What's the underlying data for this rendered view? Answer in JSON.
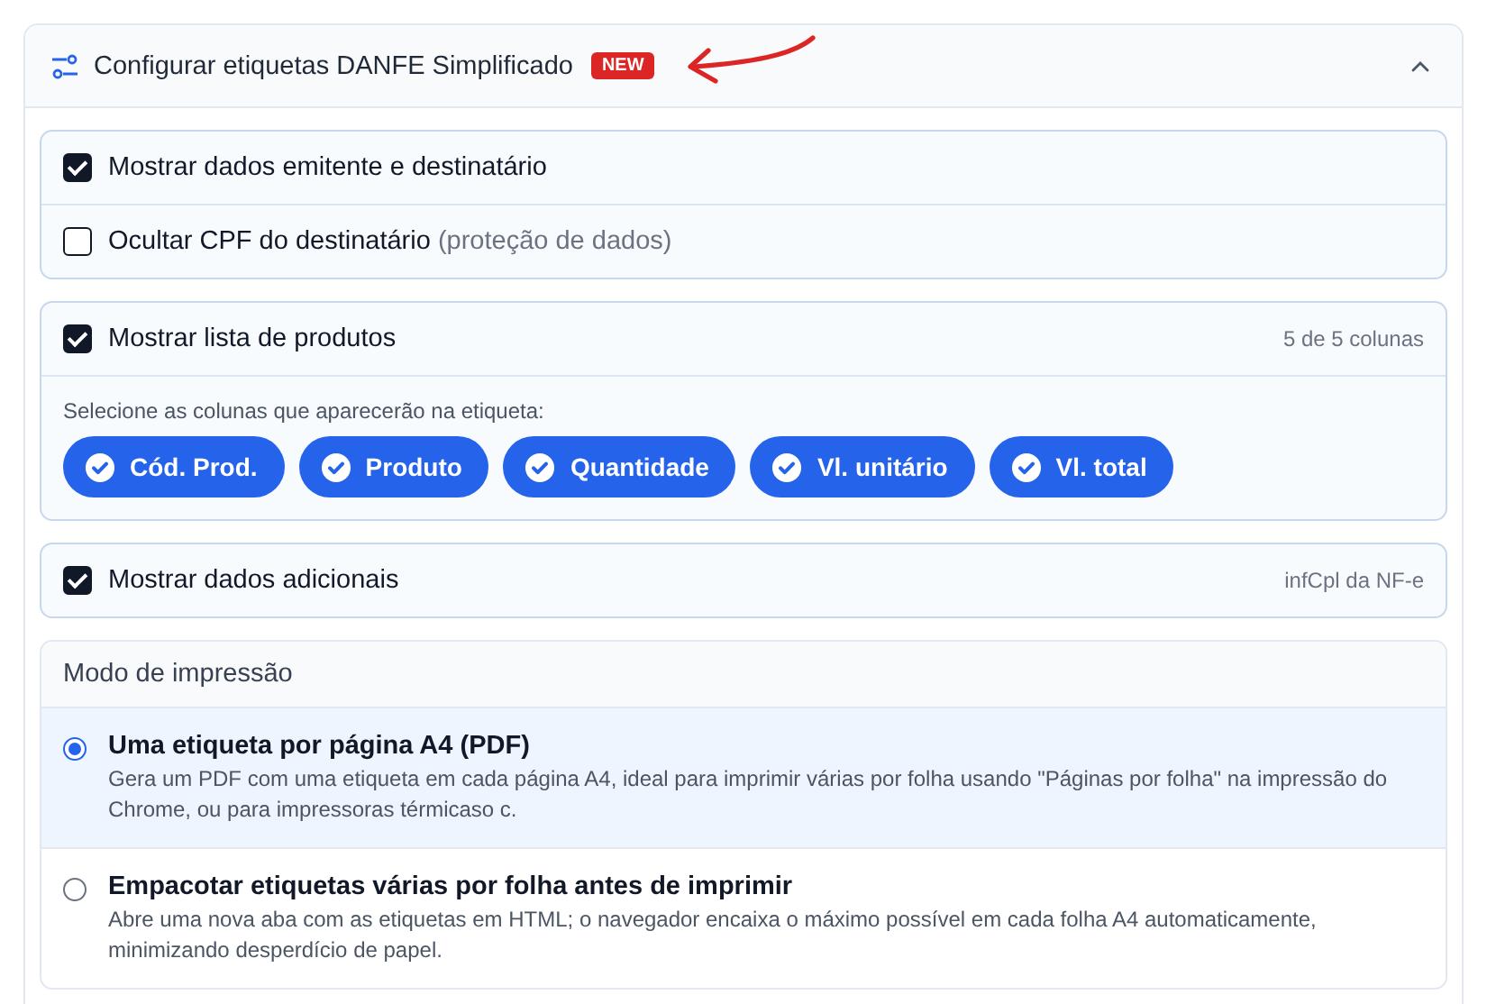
{
  "panel": {
    "title": "Configurar etiquetas DANFE Simplificado",
    "badge": "NEW",
    "expanded": true
  },
  "party_options": [
    {
      "label": "Mostrar dados emitente e destinatário",
      "checked": true
    },
    {
      "label": "Ocultar CPF do destinatário",
      "note": "(proteção de dados)",
      "checked": false
    }
  ],
  "products": {
    "label": "Mostrar lista de produtos",
    "checked": true,
    "counter": "5 de 5 colunas",
    "hint": "Selecione as colunas que aparecerão na etiqueta:",
    "columns": [
      {
        "label": "Cód. Prod.",
        "selected": true
      },
      {
        "label": "Produto",
        "selected": true
      },
      {
        "label": "Quantidade",
        "selected": true
      },
      {
        "label": "Vl. unitário",
        "selected": true
      },
      {
        "label": "Vl. total",
        "selected": true
      }
    ]
  },
  "additional": {
    "label": "Mostrar dados adicionais",
    "checked": true,
    "note": "infCpl da NF-e"
  },
  "print_mode": {
    "title": "Modo de impressão",
    "options": [
      {
        "label": "Uma etiqueta por página A4 (PDF)",
        "description": "Gera um PDF com uma etiqueta em cada página A4, ideal para imprimir várias por folha usando \"Páginas por folha\" na impressão do Chrome, ou para impressoras térmicaso c.",
        "selected": true
      },
      {
        "label": "Empacotar etiquetas várias por folha antes de imprimir",
        "description": "Abre uma nova aba com as etiquetas em HTML; o navegador encaixa o máximo possível em cada folha A4 automaticamente, minimizando desperdício de papel.",
        "selected": false
      }
    ]
  }
}
